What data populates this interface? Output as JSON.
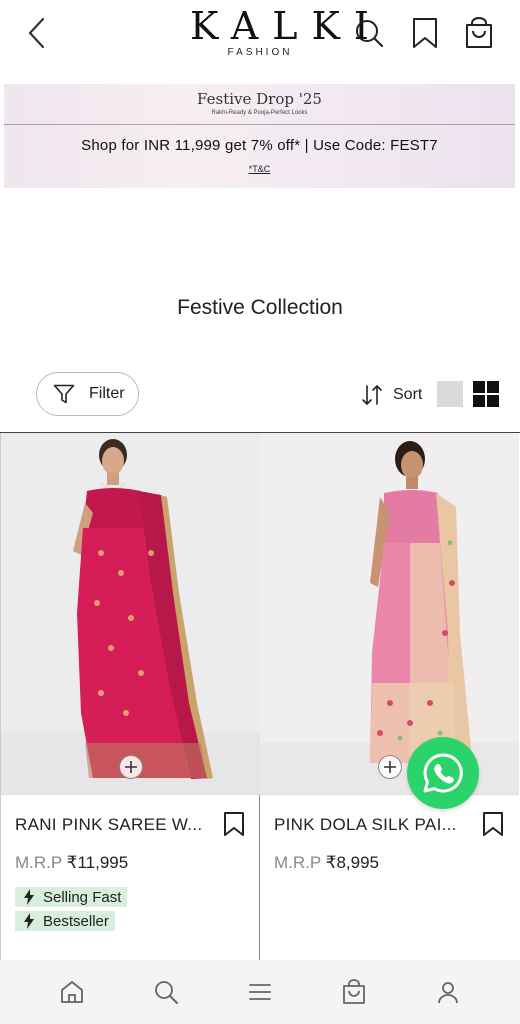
{
  "header": {
    "brand": "KALKI",
    "brand_sub": "FASHION"
  },
  "banner": {
    "title": "Festive Drop '25",
    "subtitle": "Rakhi-Ready & Pooja-Perfect Looks",
    "offer": "Shop for INR 11,999 get 7% off* | Use Code: FEST7",
    "terms": "*T&C"
  },
  "collection": {
    "title": "Festive Collection"
  },
  "toolbar": {
    "filter_label": "Filter",
    "sort_label": "Sort"
  },
  "products": [
    {
      "name": "RANI PINK SAREE W...",
      "mrp_label": "M.R.P",
      "price": "₹11,995",
      "badges": [
        "Selling Fast",
        "Bestseller"
      ]
    },
    {
      "name": "PINK DOLA SILK PAI...",
      "mrp_label": "M.R.P",
      "price": "₹8,995",
      "badges": []
    }
  ],
  "colors": {
    "badge_bg": "#d8efdd",
    "whatsapp": "#2bd46a",
    "nav_bg": "#f4f3f6"
  },
  "icons": [
    "back-icon",
    "search-icon",
    "bookmark-icon",
    "bag-icon",
    "filter-icon",
    "sort-icon",
    "list-view-icon",
    "grid-view-icon",
    "plus-icon",
    "bolt-icon",
    "whatsapp-icon",
    "home-icon",
    "menu-icon",
    "profile-icon"
  ]
}
